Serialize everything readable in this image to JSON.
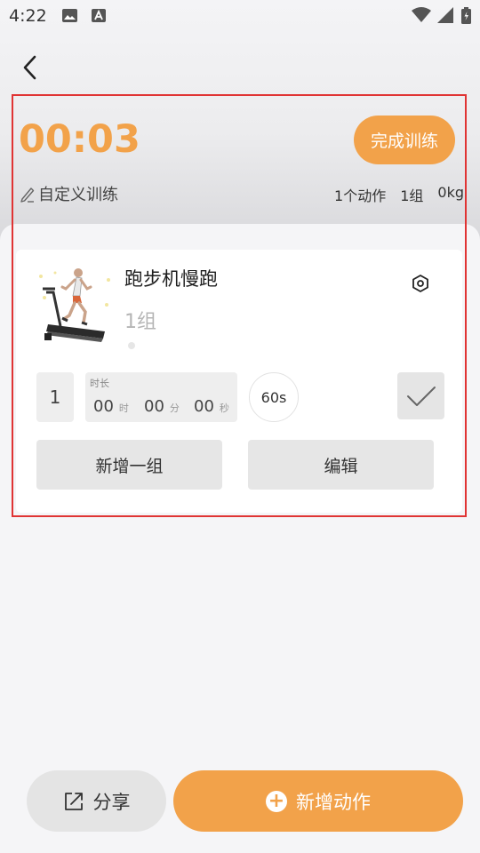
{
  "status_bar": {
    "time": "4:22"
  },
  "workout": {
    "timer": "00:03",
    "finish_label": "完成训练",
    "custom_label": "自定义训练",
    "stats": {
      "actions": "1个动作",
      "sets": "1组",
      "weight": "0kg"
    }
  },
  "exercise": {
    "name": "跑步机慢跑",
    "sets_label": "1组",
    "set_row": {
      "index": "1",
      "duration_title": "时长",
      "hours": "00",
      "hours_unit": "时",
      "minutes": "00",
      "minutes_unit": "分",
      "seconds": "00",
      "seconds_unit": "秒",
      "rest": "60s"
    },
    "add_set_label": "新增一组",
    "edit_label": "编辑"
  },
  "bottom": {
    "share_label": "分享",
    "add_action_label": "新增动作"
  },
  "colors": {
    "accent": "#f2a24a",
    "highlight": "#e03434"
  }
}
